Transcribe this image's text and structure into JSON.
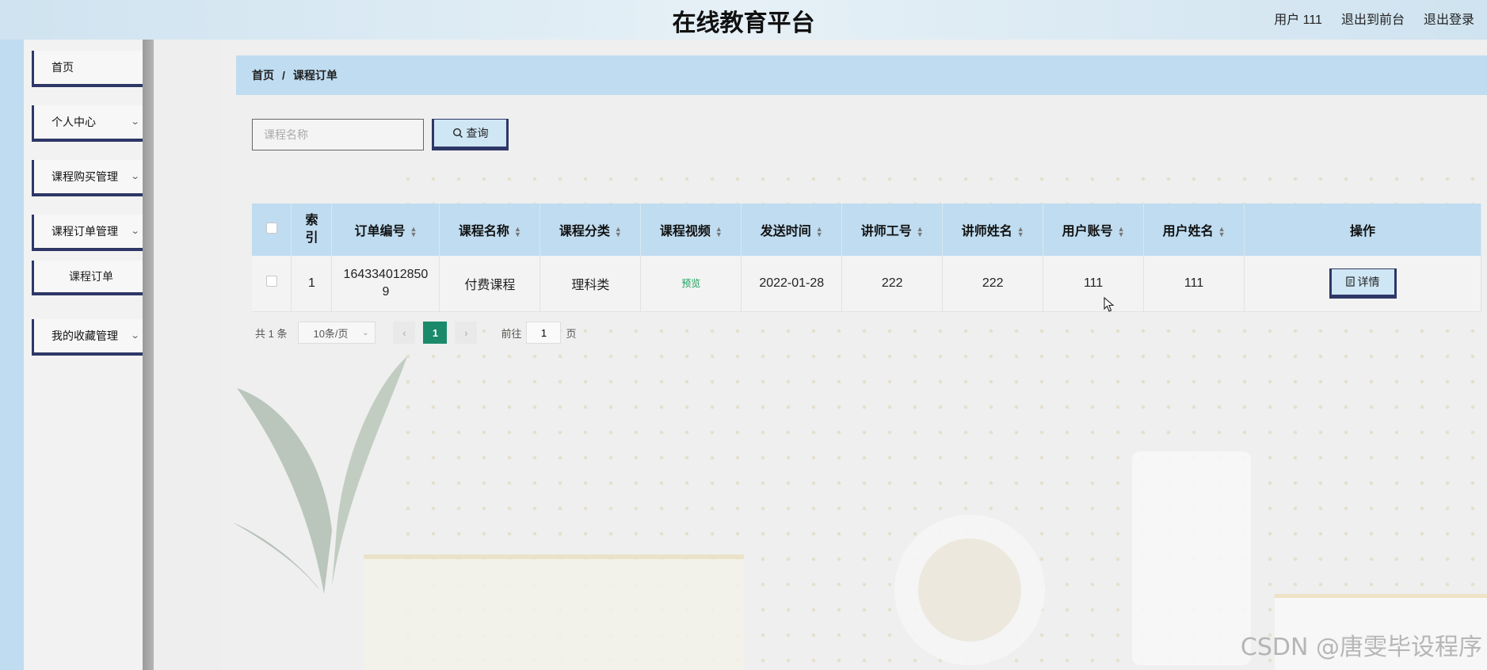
{
  "header": {
    "title": "在线教育平台",
    "user_label": "用户 111",
    "back_to_front": "退出到前台",
    "logout": "退出登录"
  },
  "sidebar": {
    "items": [
      {
        "label": "首页"
      },
      {
        "label": "个人中心"
      },
      {
        "label": "课程购买管理"
      },
      {
        "label": "课程订单管理"
      },
      {
        "label": "课程订单"
      },
      {
        "label": "我的收藏管理"
      }
    ]
  },
  "breadcrumb": {
    "home": "首页",
    "separator": "/",
    "current": "课程订单"
  },
  "search": {
    "placeholder": "课程名称",
    "button_label": "查询"
  },
  "table": {
    "columns": [
      "索引",
      "订单编号",
      "课程名称",
      "课程分类",
      "课程视频",
      "发送时间",
      "讲师工号",
      "讲师姓名",
      "用户账号",
      "用户姓名",
      "操作"
    ],
    "rows": [
      {
        "index": "1",
        "order_no": "1643340128509",
        "course_name": "付费课程",
        "category": "理科类",
        "video": "预览",
        "send_time": "2022-01-28",
        "teacher_id": "222",
        "teacher_name": "222",
        "user_account": "111",
        "user_name": "111",
        "action": "详情"
      }
    ]
  },
  "pagination": {
    "total": "共 1 条",
    "page_size": "10条/页",
    "current_page": "1",
    "goto_prefix": "前往",
    "goto_value": "1",
    "goto_suffix": "页"
  },
  "watermark": "CSDN @唐雯毕设程序",
  "colors": {
    "accent": "#bfdcf0",
    "border_dark": "#2e3766",
    "pager_active": "#1a8a6a"
  }
}
